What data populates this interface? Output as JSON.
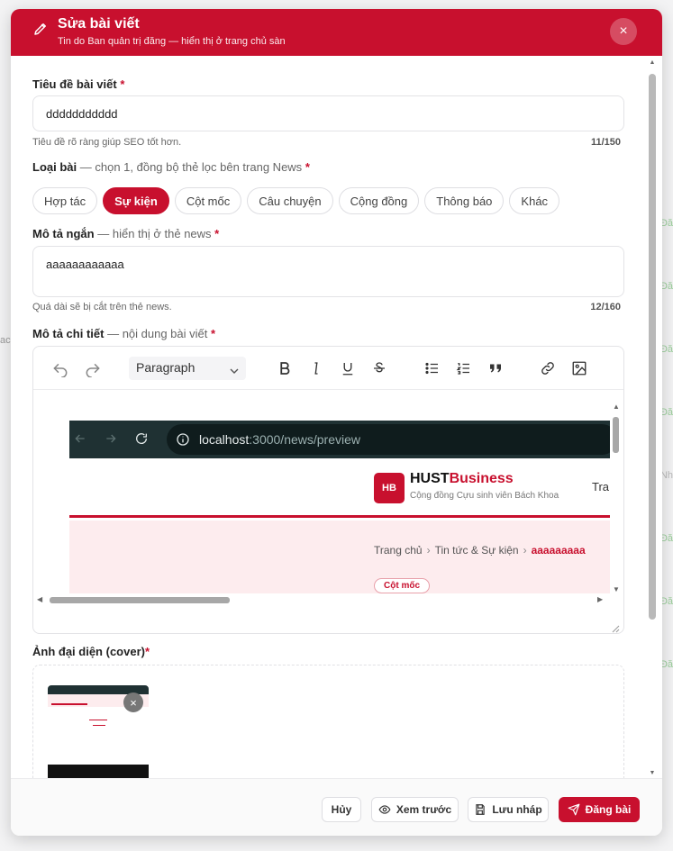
{
  "background": {
    "right_tags": [
      "Đă",
      "Đă",
      "Đă",
      "Đă",
      "Nh",
      "Đă",
      "Đă",
      "Đă"
    ],
    "left_fragment": "ac"
  },
  "modal": {
    "title": "Sửa bài viết",
    "subtitle": "Tin do Ban quản trị đăng — hiển thị ở trang chủ sàn",
    "close_label": "×"
  },
  "form": {
    "title_field": {
      "label": "Tiêu đề bài viết",
      "required": "*",
      "value": "ddddddddddd",
      "hint": "Tiêu đề rõ ràng giúp SEO tốt hơn.",
      "counter": "11/150"
    },
    "category": {
      "label": "Loại bài",
      "note": "— chọn 1, đồng bộ thẻ lọc bên trang News",
      "required": "*",
      "options": [
        "Hợp tác",
        "Sự kiện",
        "Cột mốc",
        "Câu chuyện",
        "Cộng đồng",
        "Thông báo",
        "Khác"
      ],
      "selected": "Sự kiện"
    },
    "short_desc": {
      "label": "Mô tả ngắn",
      "note": "— hiển thị ở thẻ news",
      "required": "*",
      "value": "aaaaaaaaaaaa",
      "hint": "Quá dài sẽ bị cắt trên thẻ news.",
      "counter": "12/160"
    },
    "detail": {
      "label": "Mô tả chi tiết",
      "note": "— nội dung bài viết",
      "required": "*",
      "paragraph_select": "Paragraph"
    },
    "cover": {
      "label": "Ảnh đại diện (cover)",
      "required": "*",
      "remove_label": "×"
    }
  },
  "embedded_screenshot": {
    "url_host": "localhost",
    "url_rest": ":3000/news/preview",
    "logo_text": "HB",
    "brand_black": "HUST",
    "brand_red": "Business",
    "brand_sub": "Cộng đồng Cựu sinh viên Bách Khoa",
    "nav_partial": "Tra",
    "breadcrumb": [
      "Trang chủ",
      "Tin tức & Sự kiện",
      "aaaaaaaaa"
    ],
    "breadcrumb_sep": "›",
    "badge_partial": "Cột mốc"
  },
  "footer": {
    "cancel": "Hủy",
    "preview": "Xem trước",
    "draft": "Lưu nháp",
    "publish": "Đăng bài"
  },
  "colors": {
    "brand_red": "#c8102e",
    "header_bg": "#c8102e"
  },
  "icons": [
    "pencil-icon",
    "close-icon",
    "undo-icon",
    "redo-icon",
    "chevron-down-icon",
    "bold-icon",
    "italic-icon",
    "underline-icon",
    "strikethrough-icon",
    "bullet-list-icon",
    "numbered-list-icon",
    "quote-icon",
    "link-icon",
    "image-icon",
    "info-icon",
    "eye-icon",
    "save-icon",
    "send-icon"
  ]
}
